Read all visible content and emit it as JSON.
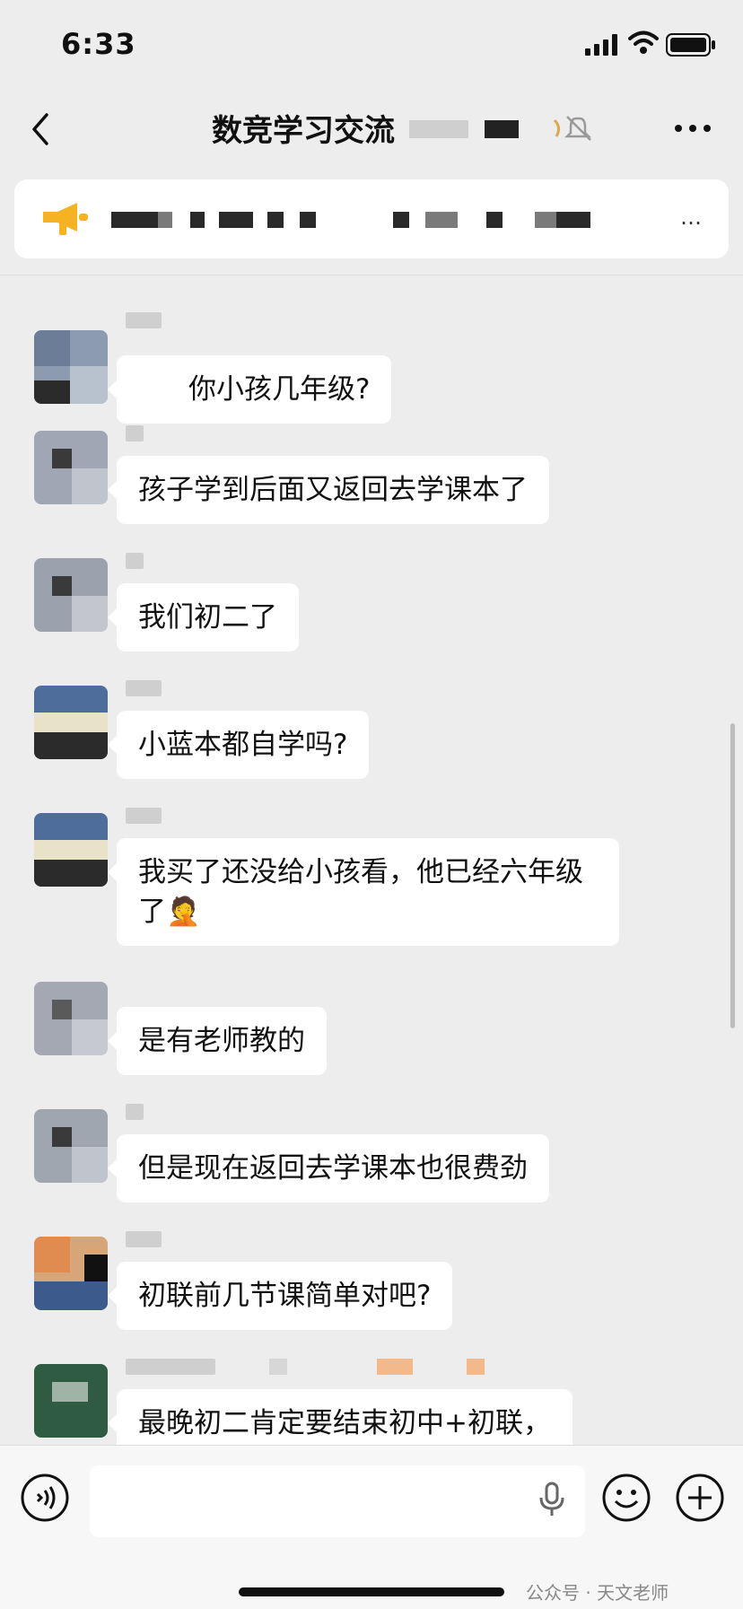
{
  "status_bar": {
    "time": "6:33"
  },
  "nav": {
    "title": "数竞学习交流"
  },
  "pinned": {
    "text": "…"
  },
  "messages": [
    {
      "text": "你小孩几年级?"
    },
    {
      "text": "孩子学到后面又返回去学课本了"
    },
    {
      "text": "我们初二了"
    },
    {
      "text": "小蓝本都自学吗?"
    },
    {
      "text": "我买了还没给小孩看，他已经六年级了🤦"
    },
    {
      "text": "是有老师教的"
    },
    {
      "text": "但是现在返回去学课本也很费劲"
    },
    {
      "text": "初联前几节课简单对吧?"
    },
    {
      "text": "最晚初二肯定要结束初中+初联，"
    }
  ],
  "watermark": "公众号 · 天文老师",
  "icons": {
    "back": "chevron-left-icon",
    "more": "more-dots-icon",
    "mute": "bell-off-icon",
    "pin": "megaphone-icon",
    "voice": "voice-icon",
    "mic": "microphone-icon",
    "emoji": "emoji-icon",
    "plus": "plus-icon"
  }
}
